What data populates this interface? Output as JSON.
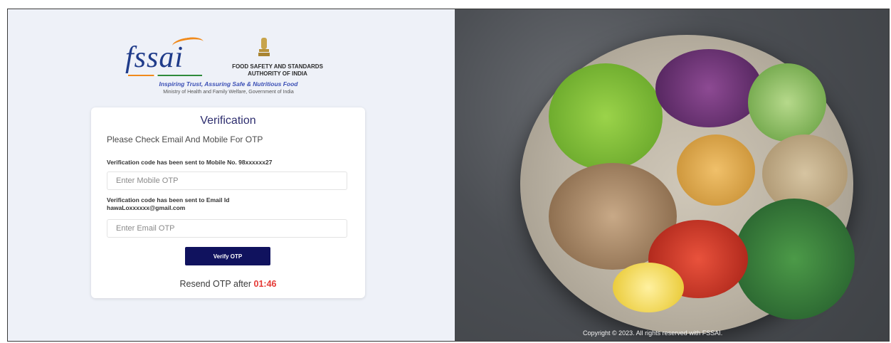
{
  "brand": {
    "logo_text": "fssai",
    "authority_line1": "FOOD SAFETY AND STANDARDS",
    "authority_line2": "AUTHORITY OF INDIA",
    "tagline": "Inspiring Trust, Assuring Safe & Nutritious Food",
    "ministry": "Ministry of Health and Family Welfare, Government of India"
  },
  "verification": {
    "title": "Verification",
    "subtitle": "Please Check Email And Mobile For OTP",
    "mobile_label": "Verification code has been sent to Mobile No. 98xxxxxx27",
    "mobile_placeholder": "Enter Mobile OTP",
    "email_label": "Verification code has been sent to Email Id hawaLoxxxxxx@gmail.com",
    "email_placeholder": "Enter Email OTP",
    "verify_label": "Verify OTP",
    "resend_text": "Resend OTP after",
    "resend_timer": "01:46"
  },
  "footer": {
    "copyright": "Copyright © 2023. All rights reserved with FSSAI."
  },
  "colors": {
    "primary_button": "#10125e",
    "timer": "#e53935",
    "title": "#2d2d6e"
  }
}
